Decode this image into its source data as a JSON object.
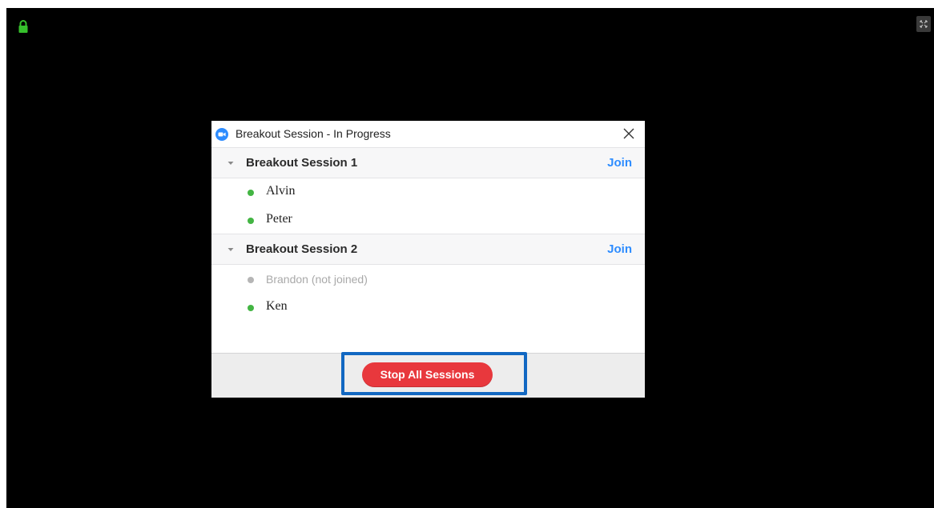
{
  "dialog": {
    "title": "Breakout Session - In Progress",
    "sessions": [
      {
        "name": "Breakout Session 1",
        "join_label": "Join",
        "participants": [
          {
            "name": "Alvin",
            "joined": true
          },
          {
            "name": "Peter",
            "joined": true
          }
        ]
      },
      {
        "name": "Breakout Session 2",
        "join_label": "Join",
        "participants": [
          {
            "name": "Brandon (not joined)",
            "joined": false
          },
          {
            "name": "Ken",
            "joined": true
          }
        ]
      }
    ],
    "stop_button_label": "Stop All Sessions"
  },
  "icons": {
    "app": "zoom-app-icon",
    "close": "close-icon",
    "collapse": "chevron-down-icon",
    "lock": "lock-icon",
    "fullscreen": "fullscreen-icon"
  },
  "colors": {
    "background": "#000000",
    "joined_status": "#43b543",
    "not_joined_status": "#b5b5b5",
    "join_link": "#2d8cff",
    "stop_button": "#e8383d",
    "highlight": "#1268c2"
  }
}
